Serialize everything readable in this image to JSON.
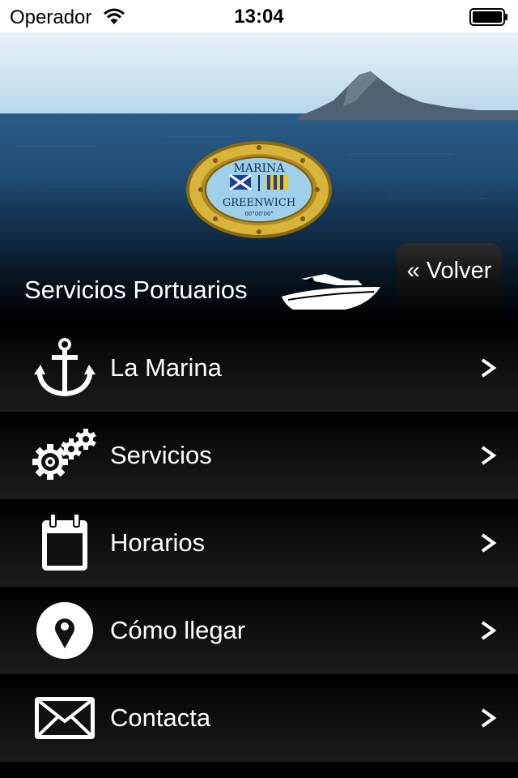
{
  "status_bar": {
    "carrier": "Operador",
    "time": "13:04",
    "wifi_icon": "wifi-icon",
    "battery_icon": "battery-icon"
  },
  "header": {
    "logo": {
      "top_text": "MARINA",
      "bottom_text": "GREENWICH",
      "coordinates": "00°00'00\"",
      "ring_color": "#c9a227",
      "inner_color": "#9fd0ea"
    },
    "section_title": "Servicios Portuarios",
    "section_icon": "boat-icon",
    "back_button": {
      "label": "« Volver"
    }
  },
  "menu": {
    "items": [
      {
        "label": "La Marina",
        "icon": "anchor-icon"
      },
      {
        "label": "Servicios",
        "icon": "gears-icon"
      },
      {
        "label": "Horarios",
        "icon": "calendar-icon"
      },
      {
        "label": "Cómo llegar",
        "icon": "location-pin-icon"
      },
      {
        "label": "Contacta",
        "icon": "envelope-icon"
      }
    ],
    "chevron_icon": "chevron-right-icon"
  },
  "colors": {
    "sea": "#1d4a73",
    "sky": "#bcd8ec",
    "menu_background": "#000000",
    "text": "#ffffff"
  }
}
